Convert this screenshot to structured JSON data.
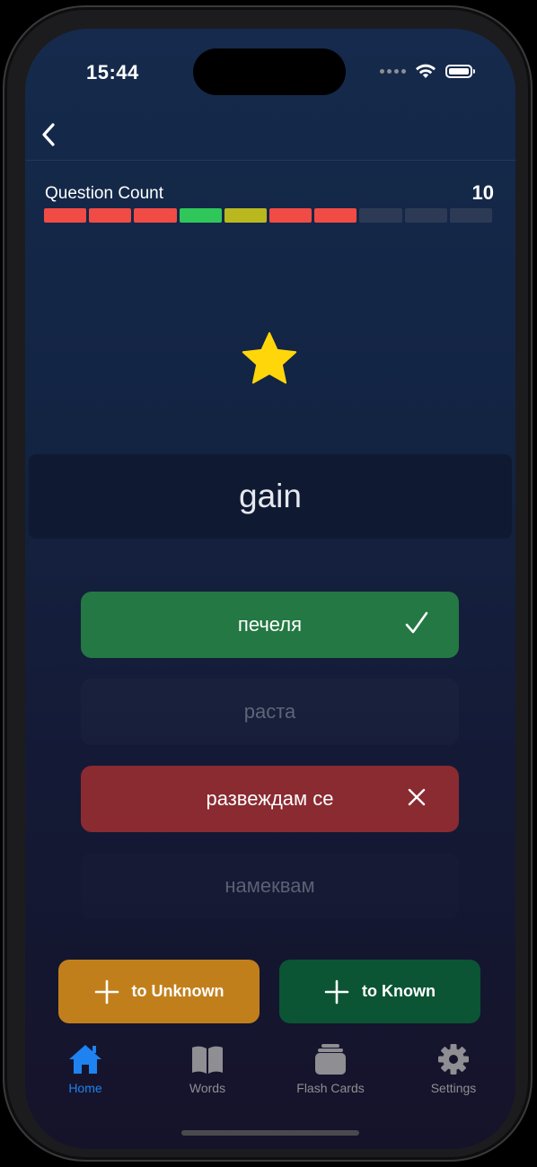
{
  "status_bar": {
    "time": "15:44"
  },
  "quiz": {
    "label": "Question Count",
    "count": "10",
    "segments": [
      "#f04b45",
      "#f04b45",
      "#f04b45",
      "#2fc75a",
      "#b9b81f",
      "#f04b45",
      "#f04b45",
      "#2d3a55",
      "#2d3a55",
      "#2d3a55"
    ],
    "word": "gain",
    "options": [
      {
        "text": "печеля",
        "state": "correct"
      },
      {
        "text": "раста",
        "state": "neutral"
      },
      {
        "text": "развеждам се",
        "state": "wrong"
      },
      {
        "text": "намеквам",
        "state": "neutral"
      }
    ]
  },
  "actions": {
    "to_unknown": "to Unknown",
    "to_known": "to Known"
  },
  "tabs": [
    {
      "label": "Home",
      "icon": "house-icon",
      "active": true
    },
    {
      "label": "Words",
      "icon": "book-icon",
      "active": false
    },
    {
      "label": "Flash Cards",
      "icon": "cards-icon",
      "active": false
    },
    {
      "label": "Settings",
      "icon": "gear-icon",
      "active": false
    }
  ],
  "colors": {
    "accent": "#1e82f0",
    "correct": "#247843",
    "wrong": "#8a2a31",
    "unknown": "#c17f1c",
    "known": "#0b5434",
    "star": "#ffd60a"
  }
}
